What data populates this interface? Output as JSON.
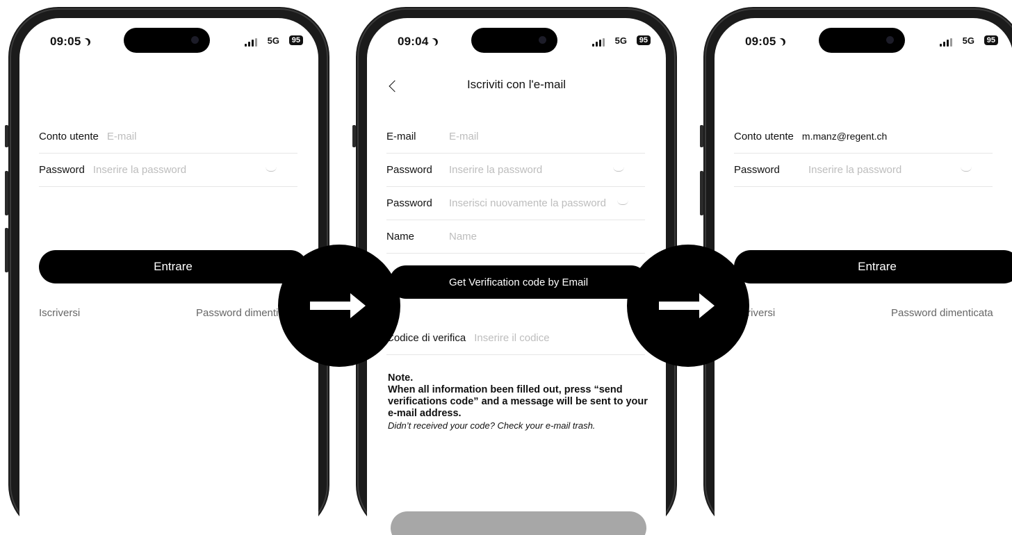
{
  "screens": [
    {
      "status": {
        "time": "09:05",
        "network": "5G",
        "battery": "95"
      },
      "fields": [
        {
          "label": "Conto utente",
          "value": "E-mail",
          "filled": false
        },
        {
          "label": "Password",
          "value": "Inserire la password",
          "filled": false
        }
      ],
      "primary_button": "Entrare",
      "links": {
        "left": "Iscriversi",
        "right": "Password dimenticata"
      }
    },
    {
      "status": {
        "time": "09:04",
        "network": "5G",
        "battery": "95"
      },
      "title": "Iscriviti con l'e-mail",
      "fields": [
        {
          "label": "E-mail",
          "value": "E-mail"
        },
        {
          "label": "Password",
          "value": "Inserire la password"
        },
        {
          "label": "Password",
          "value": "Inserisci nuovamente la password"
        },
        {
          "label": "Name",
          "value": "Name"
        }
      ],
      "verify_button": "Get Verification code by Email",
      "code_field": {
        "label": "Codice di verifica",
        "value": "Inserire il codice"
      },
      "note": {
        "heading": "Note.",
        "body": "When all information been filled out, press “send verifications code” and a message will be sent to your e-mail address.",
        "hint": "Didn’t received your code? Check your e-mail trash."
      }
    },
    {
      "status": {
        "time": "09:05",
        "network": "5G",
        "battery": "95"
      },
      "fields": [
        {
          "label": "Conto utente",
          "value": "m.manz@regent.ch",
          "filled": true
        },
        {
          "label": "Password",
          "value": "Inserire la password",
          "filled": false
        }
      ],
      "primary_button": "Entrare",
      "links": {
        "left": "Iscriversi",
        "right": "Password dimenticata"
      }
    }
  ],
  "colors": {
    "accent": "#000000",
    "placeholder": "#bdbdbd",
    "divider": "#e6e6e6",
    "disabled": "#a7a7a7"
  }
}
